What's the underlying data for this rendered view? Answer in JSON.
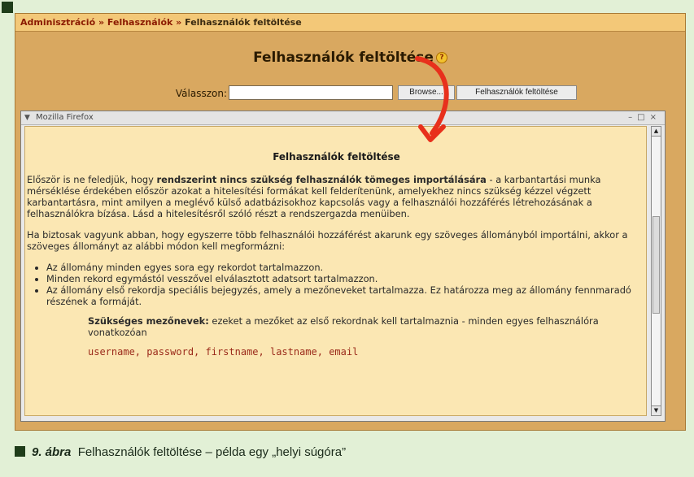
{
  "breadcrumb": {
    "item1": "Adminisztráció",
    "sep": "»",
    "item2": "Felhasználók",
    "current": "Felhasználók feltöltése"
  },
  "page_title": "Felhasználók feltöltése",
  "help_icon_glyph": "?",
  "upload": {
    "label": "Válasszon:",
    "browse_label": "Browse...",
    "submit_label": "Felhasználók feltöltése"
  },
  "popup": {
    "window_title": "Mozilla Firefox",
    "help_title": "Felhasználók feltöltése",
    "p1_before": "Először is ne feledjük, hogy ",
    "p1_bold": "rendszerint nincs szükség felhasználók tömeges importálására",
    "p1_after": " - a karbantartási munka mérséklése érdekében először azokat a hitelesítési formákat kell felderítenünk, amelyekhez nincs szükség kézzel végzett karbantartásra, mint amilyen a meglévő külső adatbázisokhoz kapcsolás vagy a felhasználói hozzáférés létrehozásának a felhasználókra bízása. Lásd a hitelesítésről szóló részt a rendszergazda menüiben.",
    "p2": "Ha biztosak vagyunk abban, hogy egyszerre több felhasználói hozzáférést akarunk egy szöveges állományból importálni, akkor a szöveges állományt az alábbi módon kell megformázni:",
    "bullets": [
      "Az állomány minden egyes sora egy rekordot tartalmazzon.",
      "Minden rekord egymástól vesszővel elválasztott adatsort tartalmazzon.",
      "Az állomány első rekordja speciális bejegyzés, amely a mezőneveket tartalmazza. Ez határozza meg az állomány fennmaradó részének a formáját."
    ],
    "required_bold": "Szükséges mezőnevek:",
    "required_text": " ezeket a mezőket az első rekordnak kell tartalmaznia - minden egyes felhasználóra vonatkozóan",
    "fields_code": "username, password, firstname, lastname, email"
  },
  "caption": {
    "number": "9. ábra",
    "text": "Felhasználók feltöltése – példa egy „helyi súgóra”"
  },
  "colors": {
    "arrow": "#e8301c",
    "breadcrumb_link": "#8b1a00"
  }
}
